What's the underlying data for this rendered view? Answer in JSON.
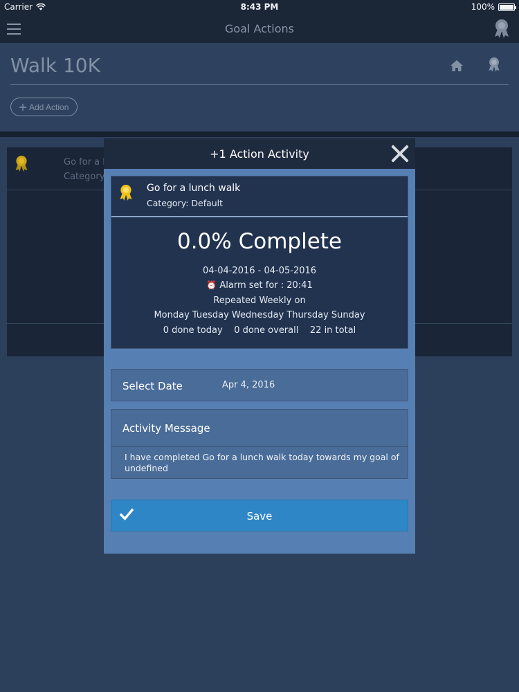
{
  "status_bar": {
    "carrier": "Carrier",
    "time": "8:43 PM",
    "battery": "100%"
  },
  "nav": {
    "title": "Goal Actions",
    "menu_icon": "hamburger-icon",
    "award_icon": "award-ribbon-icon"
  },
  "page": {
    "title": "Walk 10K",
    "add_action_label": "Add Action",
    "home_icon": "home-icon"
  },
  "background_list": {
    "items": [
      {
        "title": "Go for a l",
        "subtitle": "Category"
      }
    ]
  },
  "modal": {
    "title": "+1 Action Activity",
    "close_icon": "close-icon",
    "action": {
      "name": "Go for a lunch walk",
      "category": "Category: Default",
      "complete_text": "0.0% Complete",
      "date_range": "04-04-2016 - 04-05-2016",
      "alarm_glyph": "⏰",
      "alarm": "Alarm set for : 20:41",
      "repeat": "Repeated Weekly on",
      "days": "Monday Tuesday Wednesday Thursday Sunday",
      "done_today": "0 done today",
      "done_overall": "0 done overall",
      "in_total": "22 in total"
    },
    "select_date": {
      "label": "Select Date",
      "value": "Apr 4, 2016"
    },
    "message": {
      "label": "Activity Message",
      "text": "I have completed Go for a lunch walk today towards my goal of undefined"
    },
    "save_label": "Save"
  },
  "colors": {
    "accent": "#2f86c6",
    "ribbon": "#f2c21b",
    "modal": "#5680b3",
    "background": "#2c3f5b"
  }
}
